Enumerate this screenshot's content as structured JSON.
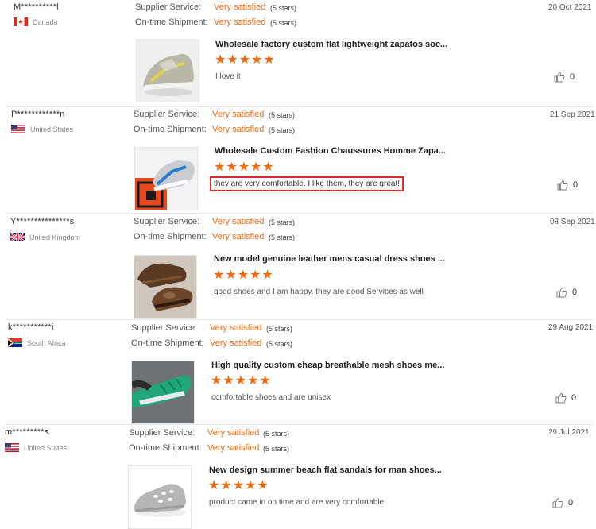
{
  "labels": {
    "supplier_service": "Supplier Service:",
    "ontime_shipment": "On-time Shipment:"
  },
  "reviews": [
    {
      "buyer": "M**********l",
      "country": "Canada",
      "flag": "canada-flag-icon",
      "supplier_value": "Very satisfied",
      "supplier_stars": "(5 stars)",
      "shipment_value": "Very satisfied",
      "shipment_stars": "(5 stars)",
      "date": "20 Oct 2021",
      "product_title": "Wholesale factory custom flat lightweight zapatos soc...",
      "rating": 5,
      "review_text": "I love it",
      "likes": "0",
      "highlighted": false
    },
    {
      "buyer": "P************n",
      "country": "United States",
      "flag": "usa-flag-icon",
      "supplier_value": "Very satisfied",
      "supplier_stars": "(5 stars)",
      "shipment_value": "Very satisfied",
      "shipment_stars": "(5 stars)",
      "date": "21 Sep 2021",
      "product_title": "Wholesale Custom Fashion Chaussures Homme Zapa...",
      "rating": 5,
      "review_text": "they are very comfortable. I like them, they are great!",
      "likes": "0",
      "highlighted": true
    },
    {
      "buyer": "Y***************s",
      "country": "United Kingdom",
      "flag": "uk-flag-icon",
      "supplier_value": "Very satisfied",
      "supplier_stars": "(5 stars)",
      "shipment_value": "Very satisfied",
      "shipment_stars": "(5 stars)",
      "date": "08 Sep 2021",
      "product_title": "New model genuine leather mens casual dress shoes ...",
      "rating": 5,
      "review_text": "good shoes and I am happy. they are good Services as well",
      "likes": "0",
      "highlighted": false
    },
    {
      "buyer": "k***********i",
      "country": "South Africa",
      "flag": "south-africa-flag-icon",
      "supplier_value": "Very satisfied",
      "supplier_stars": "(5 stars)",
      "shipment_value": "Very satisfied",
      "shipment_stars": "(5 stars)",
      "date": "29 Aug 2021",
      "product_title": "High quality custom cheap breathable mesh shoes me...",
      "rating": 5,
      "review_text": "comfortable shoes and are unisex",
      "likes": "0",
      "highlighted": false
    },
    {
      "buyer": "m*********s",
      "country": "United States",
      "flag": "usa-flag-icon",
      "supplier_value": "Very satisfied",
      "supplier_stars": "(5 stars)",
      "shipment_value": "Very satisfied",
      "shipment_stars": "(5 stars)",
      "date": "29 Jul 2021",
      "product_title": "New design summer beach flat sandals for man shoes...",
      "rating": 5,
      "review_text": "product came in on time and are very comfortable",
      "likes": "0",
      "highlighted": false
    }
  ],
  "colors": {
    "accent": "#f26b0f",
    "highlight_border": "#e02a2a"
  }
}
